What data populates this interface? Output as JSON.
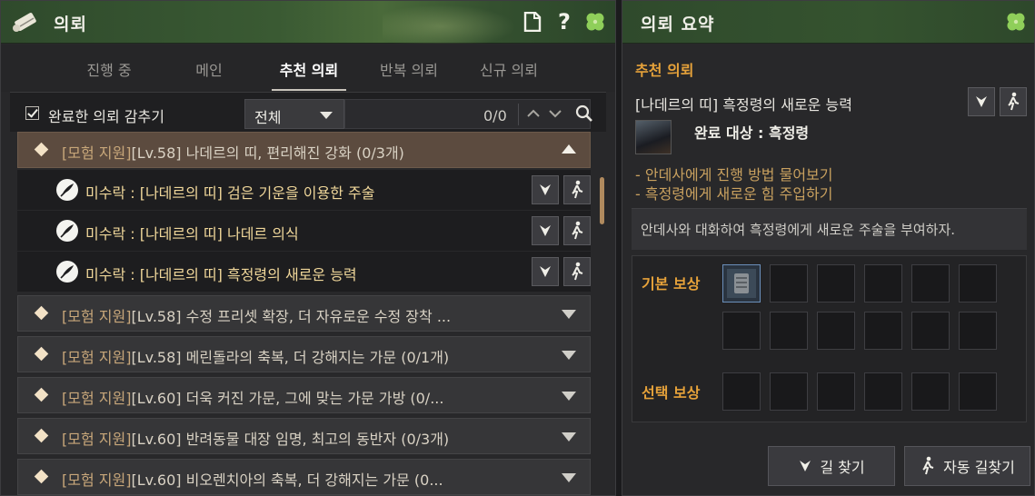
{
  "quest_window": {
    "title": "의뢰",
    "icons": [
      "scroll-icon",
      "document-icon",
      "help-icon",
      "clover-icon"
    ],
    "help_glyph": "?",
    "tabs": [
      {
        "label": "진행 중",
        "active": false
      },
      {
        "label": "메인",
        "active": false
      },
      {
        "label": "추천 의뢰",
        "active": true
      },
      {
        "label": "반복 의뢰",
        "active": false
      },
      {
        "label": "신규 의뢰",
        "active": false
      }
    ],
    "filter": {
      "hide_completed_label": "완료한 의뢰 감추기",
      "hide_completed_checked": true,
      "dropdown_value": "전체",
      "count": "0/0"
    },
    "groups": [
      {
        "tag": "[모험 지원]",
        "text": "[Lv.58] 나데르의 띠, 편리해진 강화 (0/3개)",
        "expanded": true,
        "items": [
          "미수락 : [나데르의 띠] 검은 기운을 이용한 주술",
          "미수락 : [나데르의 띠] 나데르 의식",
          "미수락 : [나데르의 띠] 흑정령의 새로운 능력"
        ]
      },
      {
        "tag": "[모험 지원]",
        "text": "[Lv.58] 수정 프리셋 확장, 더 자유로운 수정 장착 ...",
        "expanded": false
      },
      {
        "tag": "[모험 지원]",
        "text": "[Lv.58] 메린돌라의 축복, 더 강해지는 가문 (0/1개)",
        "expanded": false
      },
      {
        "tag": "[모험 지원]",
        "text": "[Lv.60] 더욱 커진 가문, 그에 맞는 가문 가방 (0/...",
        "expanded": false
      },
      {
        "tag": "[모험 지원]",
        "text": "[Lv.60] 반려동물 대장 임명, 최고의 동반자 (0/3개)",
        "expanded": false
      },
      {
        "tag": "[모험 지원]",
        "text": "[Lv.60] 비오렌치아의 축복, 더 강해지는 가문 (0...",
        "expanded": false
      }
    ]
  },
  "summary_window": {
    "title": "의뢰 요약",
    "section": "추천 의뢰",
    "quest_title": "[나데르의 띠] 흑정령의 새로운 능력",
    "target": "완료 대상 : 흑정령",
    "objectives": [
      "- 안데사에게 진행 방법 물어보기",
      "- 흑정령에게 새로운 힘 주입하기"
    ],
    "description": "안데사와 대화하여 흑정령에게 새로운 주술을 부여하자.",
    "basic_reward_label": "기본 보상",
    "choice_reward_label": "선택 보상",
    "pathfind_label": "길 찾기",
    "auto_pathfind_label": "자동 길찾기"
  },
  "colors": {
    "accent_orange": "#e6a23a",
    "quest_yellow": "#f0d79a",
    "title_green": "#35532f",
    "expanded_row": "#5c4b3f"
  }
}
